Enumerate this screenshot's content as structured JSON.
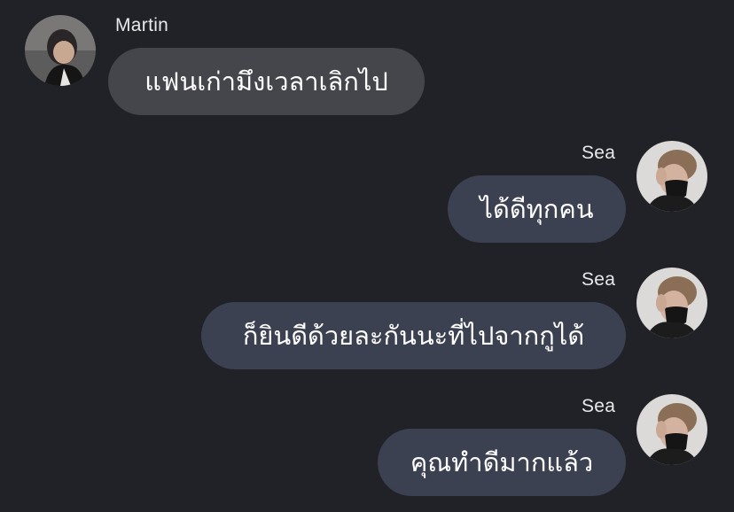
{
  "messages": [
    {
      "sender": "Martin",
      "text": "แฟนเก่ามึงเวลาเลิกไป",
      "direction": "incoming"
    },
    {
      "sender": "Sea",
      "text": "ได้ดีทุกคน",
      "direction": "outgoing"
    },
    {
      "sender": "Sea",
      "text": "ก็ยินดีด้วยละกันนะที่ไปจากกูได้",
      "direction": "outgoing"
    },
    {
      "sender": "Sea",
      "text": "คุณทำดีมากแล้ว",
      "direction": "outgoing"
    }
  ],
  "colors": {
    "background": "#212227",
    "incoming_bubble": "#45464b",
    "outgoing_bubble": "#3c4152",
    "text": "#ffffff"
  }
}
